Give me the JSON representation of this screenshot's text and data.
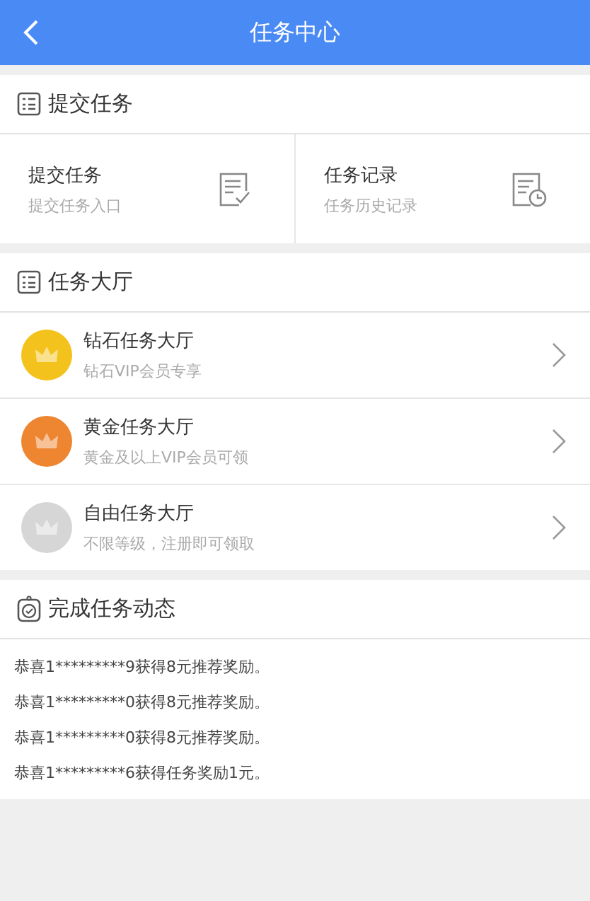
{
  "header": {
    "title": "任务中心"
  },
  "submit_section": {
    "title": "提交任务",
    "cards": [
      {
        "kind": "submit",
        "title": "提交任务",
        "subtitle": "提交任务入口"
      },
      {
        "kind": "record",
        "title": "任务记录",
        "subtitle": "任务历史记录"
      }
    ]
  },
  "hall_section": {
    "title": "任务大厅",
    "items": [
      {
        "title": "钻石任务大厅",
        "subtitle": "钻石VIP会员专享",
        "color": "#f4c21c"
      },
      {
        "title": "黄金任务大厅",
        "subtitle": "黄金及以上VIP会员可领",
        "color": "#ee8530"
      },
      {
        "title": "自由任务大厅",
        "subtitle": "不限等级，注册即可领取",
        "color": "#d6d6d6"
      }
    ]
  },
  "feed_section": {
    "title": "完成任务动态",
    "items": [
      "恭喜1*********9获得8元推荐奖励。",
      "恭喜1*********0获得8元推荐奖励。",
      "恭喜1*********0获得8元推荐奖励。",
      "恭喜1*********6获得任务奖励1元。"
    ]
  }
}
